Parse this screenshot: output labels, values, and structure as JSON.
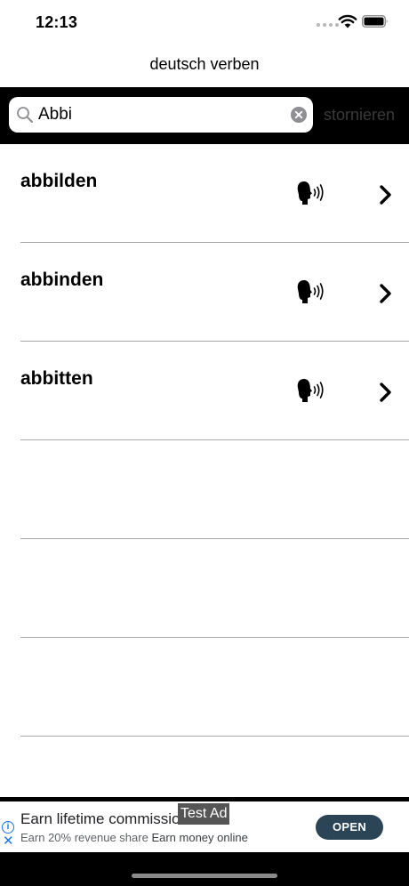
{
  "status_bar": {
    "time": "12:13"
  },
  "nav": {
    "title": "deutsch verben"
  },
  "search": {
    "value": "Abbi",
    "cancel_label": "stornieren"
  },
  "verbs": [
    {
      "label": "abbilden"
    },
    {
      "label": "abbinden"
    },
    {
      "label": "abbitten"
    }
  ],
  "empty_rows": 3,
  "ad": {
    "title": "Earn lifetime commissions",
    "subtitle_a": "Earn 20% revenue share",
    "subtitle_b": "Earn money online",
    "test_label": "Test Ad",
    "open_label": "OPEN"
  },
  "colors": {
    "search_bar_bg": "#000000",
    "ad_button": "#2b4557",
    "ad_icon": "#1a73e8"
  }
}
